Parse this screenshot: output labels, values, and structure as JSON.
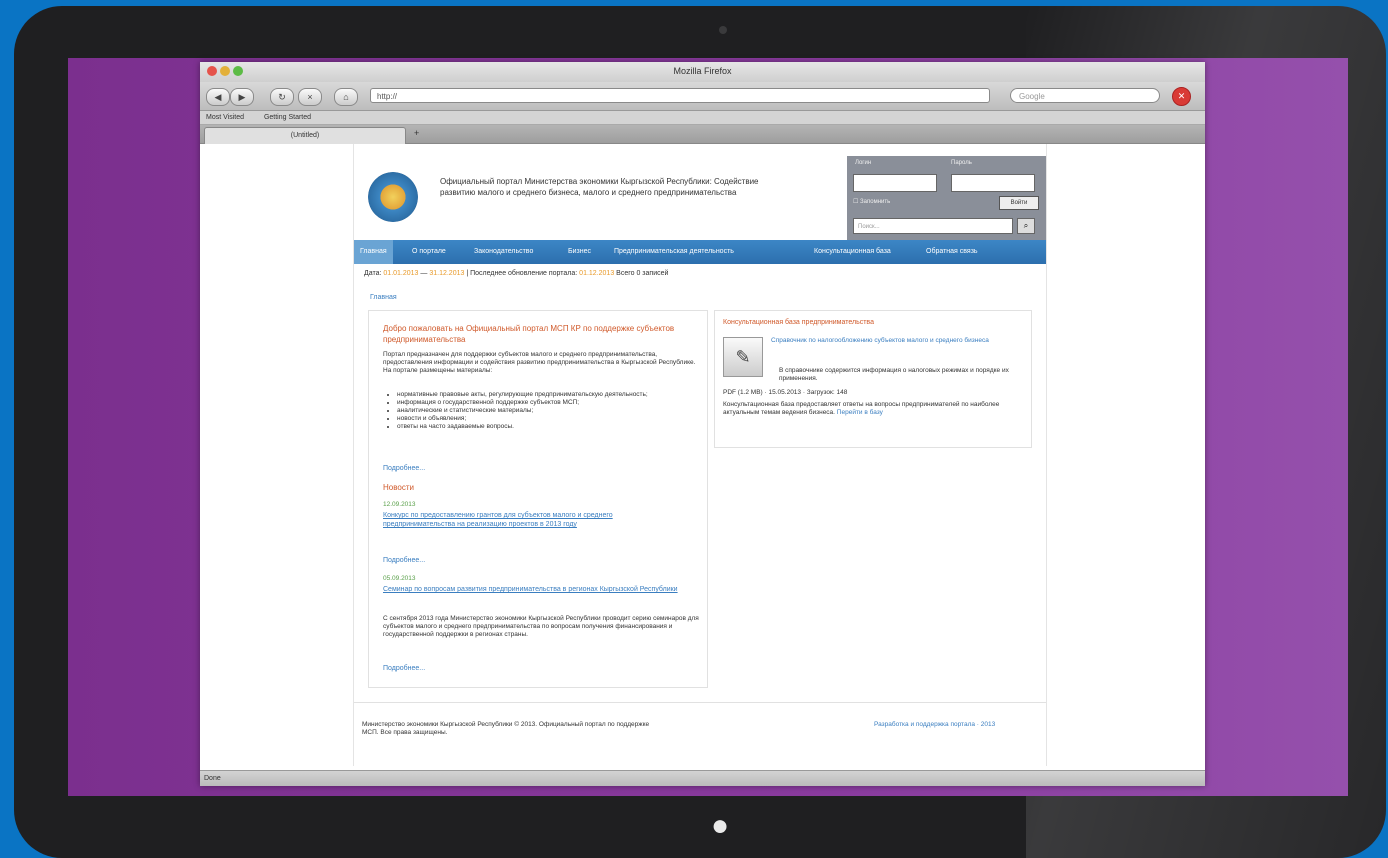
{
  "browser": {
    "window_title": "Mozilla Firefox",
    "back": "◀",
    "forward": "▶",
    "reload": "↻",
    "home": "⌂",
    "url": "http://",
    "search_placeholder": "Google",
    "stop": "✕",
    "bookmarks": [
      "Most Visited",
      "Getting Started"
    ],
    "tab_label": "(Untitled)",
    "tab_add": "+",
    "status": "Done"
  },
  "site": {
    "org_title": "Официальный портал Министерства экономики Кыргызской Республики: Содействие развитию малого и среднего бизнеса, малого и среднего предпринимательства",
    "login": {
      "login_label": "Логин",
      "password_label": "Пароль",
      "remember": "Запомнить",
      "button": "Войти",
      "search_placeholder": "Поиск..."
    },
    "menu": [
      "Главная",
      "О портале",
      "Законодательство",
      "Бизнес",
      "Предпринимательская деятельность",
      "Консультационная база",
      "Обратная связь"
    ],
    "infobar": {
      "prefix": "Дата:",
      "date1": "01.01.2013",
      "date2": "31.12.2013",
      "mid": "Последнее обновление портала:",
      "date3": "01.12.2013",
      "suffix": "Всего 0 записей"
    },
    "breadcrumb": "Главная",
    "welcome": "Добро пожаловать на Официальный портал МСП КР по поддержке субъектов предпринимательства",
    "intro": "Портал предназначен для поддержки субъектов малого и среднего предпринимательства, предоставления информации и содействия развитию предпринимательства в Кыргызской Республике. На портале размещены материалы:",
    "intro_link": "предпринимательства",
    "bullets": [
      "нормативные правовые акты, регулирующие предпринимательскую деятельность;",
      "информация о государственной поддержке субъектов МСП;",
      "аналитические и статистические материалы;",
      "новости и объявления;",
      "ответы на часто задаваемые вопросы."
    ],
    "more": "Подробнее...",
    "news_title": "Новости",
    "news": [
      {
        "date": "12.09.2013",
        "link": "Конкурс по предоставлению грантов для субъектов малого и среднего предпринимательства на реализацию проектов в 2013 году",
        "more": "Подробнее..."
      },
      {
        "date": "05.09.2013",
        "link": "Семинар по вопросам развития предпринимательства в регионах Кыргызской Республики",
        "text": "С сентября 2013 года Министерство экономики Кыргызской Республики проводит серию семинаров для субъектов малого и среднего предпринимательства по вопросам получения финансирования и государственной поддержки в регионах страны.",
        "more": "Подробнее..."
      }
    ],
    "right": {
      "title": "Консультационная база предпринимательства",
      "icon": "✎",
      "link": "Справочник по налогообложению субъектов малого и среднего бизнеса",
      "desc": "В справочнике содержится информация о налоговых режимах и порядке их применения.",
      "meta": "PDF (1.2 MB) · 15.05.2013 · Загрузок: 148",
      "text": "Консультационная база предоставляет ответы на вопросы предпринимателей по наиболее актуальным темам ведения бизнеса.",
      "text_link": "Перейти в базу"
    },
    "footer": {
      "left": "Министерство экономики Кыргызской Республики © 2013. Официальный портал по поддержке МСП. Все права защищены.",
      "right": "Разработка и поддержка портала · 2013"
    }
  }
}
